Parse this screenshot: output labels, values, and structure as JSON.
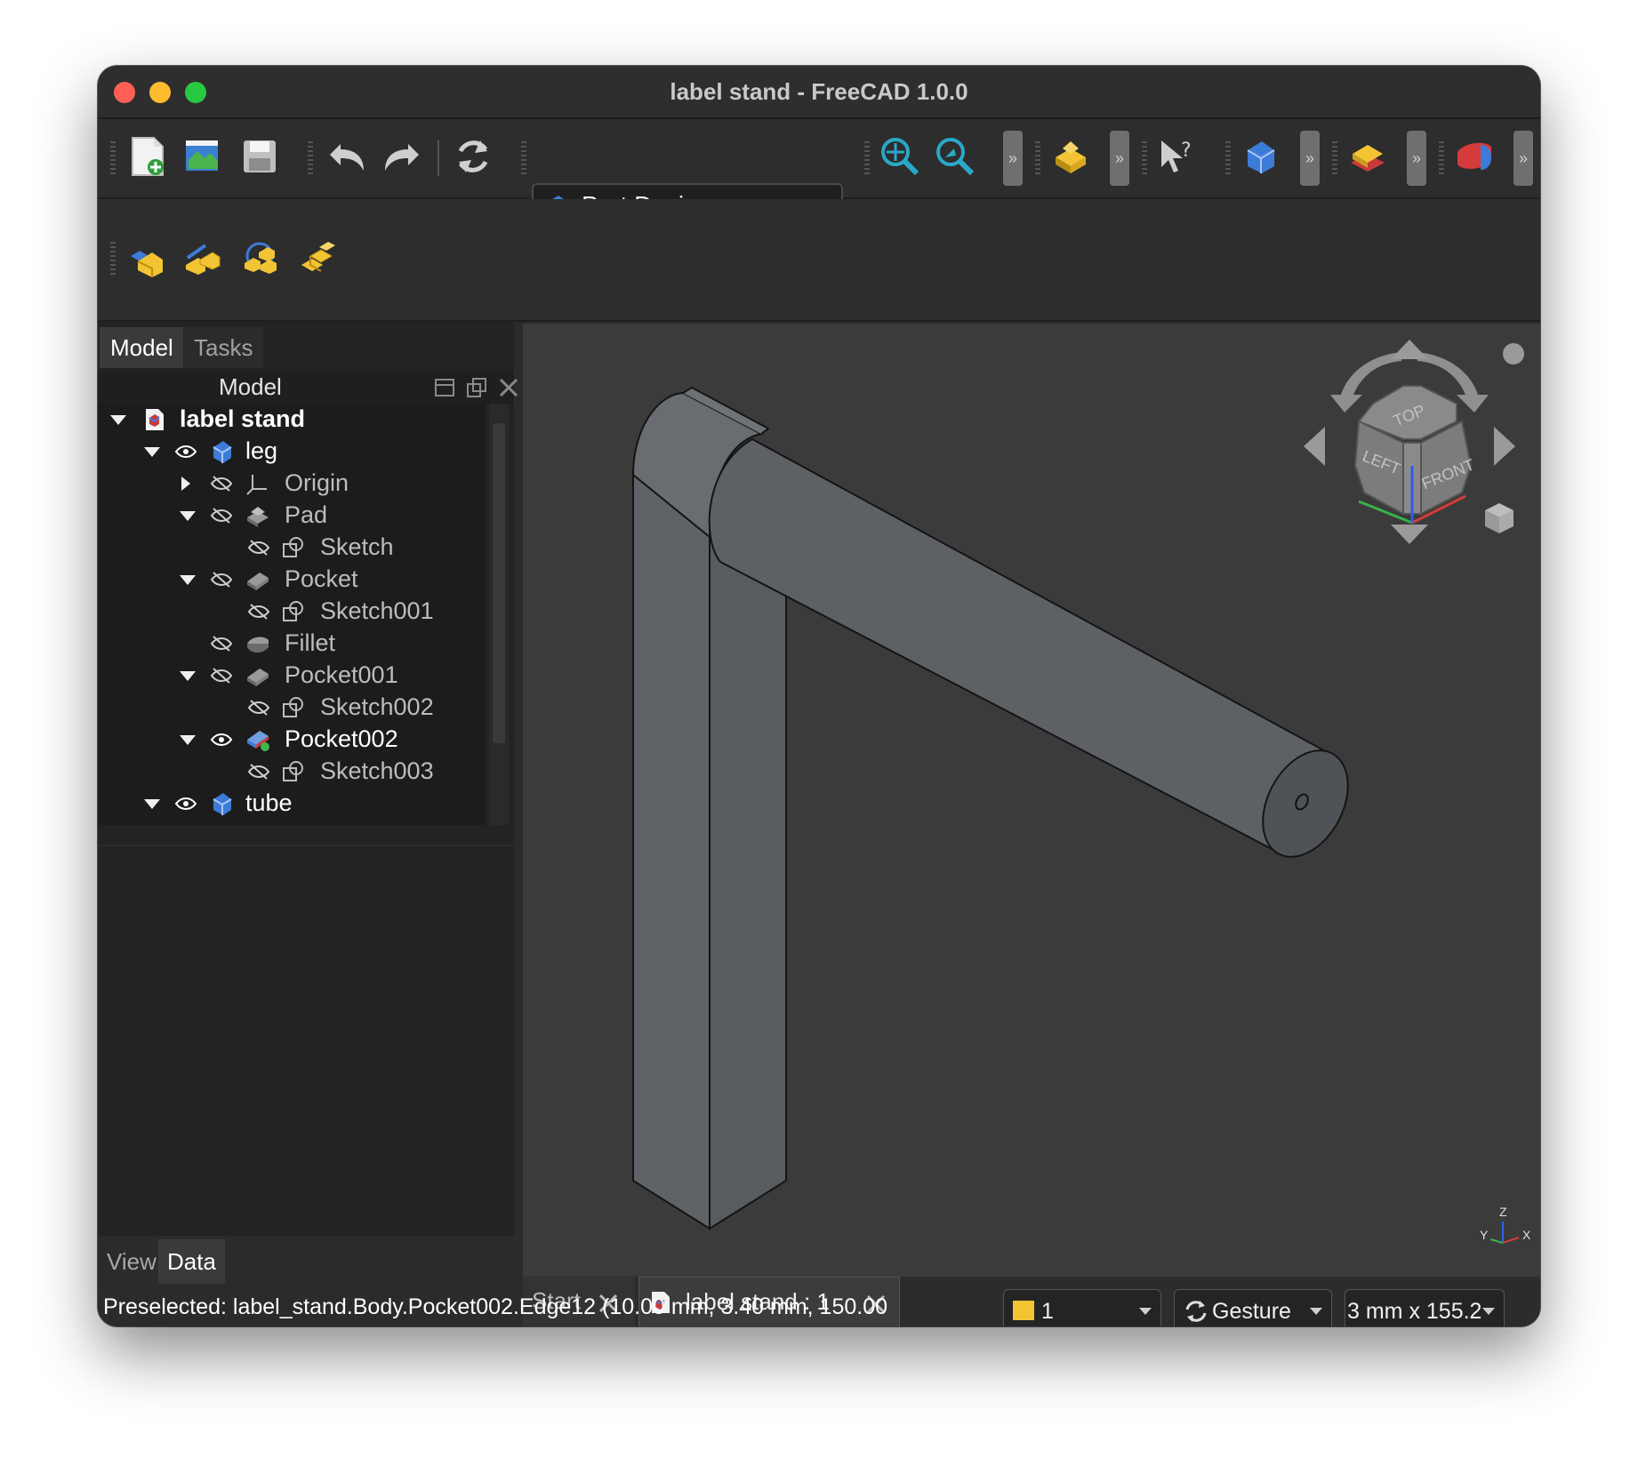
{
  "window": {
    "title": "label stand - FreeCAD 1.0.0"
  },
  "toolbar": {
    "workbench": "Part Design",
    "more_glyph": "»"
  },
  "combo": {
    "tabs": [
      "Model",
      "Tasks"
    ],
    "active_tab": "Model",
    "header_title": "Model"
  },
  "tree": {
    "items": [
      {
        "label": "label stand",
        "icon": "freecad-document-icon",
        "expanded": true
      },
      {
        "label": "leg",
        "icon": "body-icon",
        "visible": true
      },
      {
        "label": "Origin",
        "icon": "origin-icon",
        "visible": false
      },
      {
        "label": "Pad",
        "icon": "pad-icon",
        "visible": false
      },
      {
        "label": "Sketch",
        "icon": "sketch-icon",
        "visible": false
      },
      {
        "label": "Pocket",
        "icon": "pocket-icon",
        "visible": false
      },
      {
        "label": "Sketch001",
        "icon": "sketch-icon",
        "visible": false
      },
      {
        "label": "Fillet",
        "icon": "fillet-icon",
        "visible": false
      },
      {
        "label": "Pocket001",
        "icon": "pocket-icon",
        "visible": false
      },
      {
        "label": "Sketch002",
        "icon": "sketch-icon",
        "visible": false
      },
      {
        "label": "Pocket002",
        "icon": "pocket-tip-icon",
        "visible": true
      },
      {
        "label": "Sketch003",
        "icon": "sketch-icon",
        "visible": false
      },
      {
        "label": "tube",
        "icon": "body-icon",
        "visible": true
      }
    ]
  },
  "property_tabs": [
    "View",
    "Data"
  ],
  "active_property_tab": "Data",
  "navcube": {
    "faces": [
      "TOP",
      "LEFT",
      "FRONT"
    ]
  },
  "axis_indicator": {
    "z": "Z",
    "y": "Y",
    "x": "X"
  },
  "document_tabs": {
    "start": "Start",
    "document": "label stand : 1"
  },
  "status": {
    "message": "Preselected: label_stand.Body.Pocket002.Edge12 (10.00 mm, 3.40 mm, 150.00",
    "draw_style": "1",
    "navigation": "Gesture",
    "dimensions": "3 mm x 155.2"
  },
  "colors": {
    "accent_blue": "#3d7bd9",
    "part_yellow": "#f2c433",
    "model_gray": "#5f6368"
  }
}
